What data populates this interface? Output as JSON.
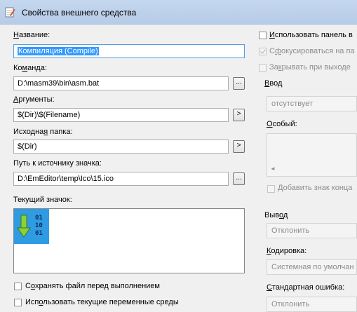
{
  "window": {
    "title": "Свойства внешнего средства",
    "title_icon": "notepad-pencil-icon"
  },
  "left": {
    "name_label": "Название:",
    "name_value": "Компиляция (Compile)",
    "command_label": "Команда:",
    "command_value": "D:\\masm39\\bin\\asm.bat",
    "command_browse": "...",
    "arguments_label": "Аргументы:",
    "arguments_value": "$(Dir)\\$(Filename)",
    "arguments_menu": ">",
    "initial_folder_label": "Исходная папка:",
    "initial_folder_value": "$(Dir)",
    "initial_folder_menu": ">",
    "icon_path_label": "Путь к источнику значка:",
    "icon_path_value": "D:\\EmEditor\\temp\\Ico\\15.ico",
    "icon_path_browse": "...",
    "current_icon_label": "Текущий значок:",
    "icon_digits": [
      "01",
      "10",
      "01"
    ],
    "save_file_label": "Сохранять файл перед выполнением",
    "use_env_label": "Использовать текущие переменные среды"
  },
  "right": {
    "use_output_panel_label": "Использовать панель в",
    "focus_label": "Сфокусироваться на па",
    "close_on_exit_label": "Закрывать при выходе",
    "input_group_label": "Ввод",
    "input_value": "отсутствует",
    "special_label": "Особый:",
    "scroll_left": "◄",
    "add_eol_label": "Добавить знак конца",
    "output_group_label": "Вывод",
    "output_value": "Отклонить",
    "encoding_label": "Кодировка:",
    "encoding_value": "Системная по умолчан",
    "stderr_label": "Стандартная ошибка:",
    "stderr_value": "Отклонить"
  }
}
